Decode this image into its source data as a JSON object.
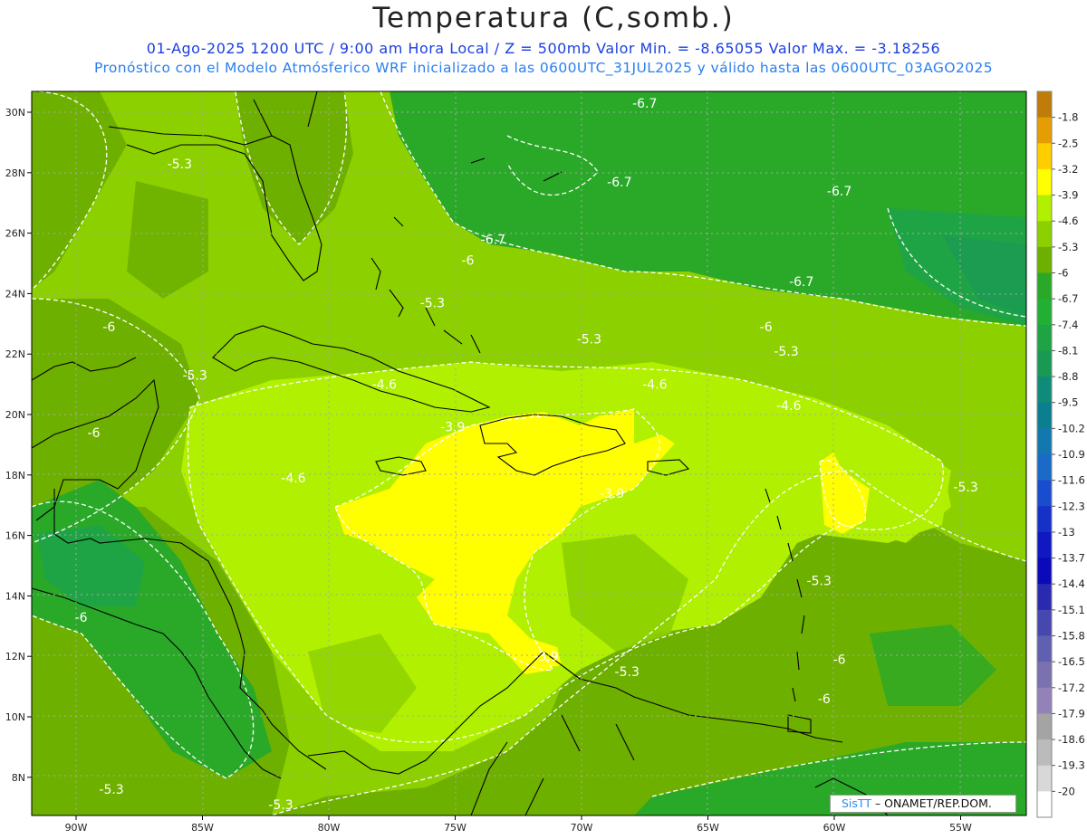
{
  "header": {
    "title": "Temperatura (C,somb.)",
    "line1": "01-Ago-2025  1200 UTC / 9:00 am Hora Local / Z = 500mb  Valor Min. = -8.65055  Valor Max. = -3.18256",
    "line2": "Pronóstico con el Modelo Atmósferico WRF inicializado a las 0600UTC_31JUL2025 y válido hasta las  0600UTC_03AGO2025"
  },
  "credit": {
    "brand": "SisTT",
    "org": " – ONAMET/REP.DOM."
  },
  "map": {
    "lat_labels": [
      "30N",
      "28N",
      "26N",
      "24N",
      "22N",
      "20N",
      "18N",
      "16N",
      "14N",
      "12N",
      "10N",
      "8N"
    ],
    "lon_labels": [
      "90W",
      "85W",
      "80W",
      "75W",
      "70W",
      "65W",
      "60W",
      "55W"
    ],
    "lat_values": [
      30,
      28,
      26,
      24,
      22,
      20,
      18,
      16,
      14,
      12,
      10,
      8
    ],
    "lon_values": [
      -90,
      -85,
      -80,
      -75,
      -70,
      -65,
      -60,
      -55
    ],
    "contour_labels": [
      {
        "text": "-6.7",
        "lon": -67.5,
        "lat": 30.3
      },
      {
        "text": "-6.7",
        "lon": -68.5,
        "lat": 27.7
      },
      {
        "text": "-6.7",
        "lon": -59.8,
        "lat": 27.4
      },
      {
        "text": "-6.7",
        "lon": -73.5,
        "lat": 25.8
      },
      {
        "text": "-6.7",
        "lon": -61.3,
        "lat": 24.4
      },
      {
        "text": "-5.3",
        "lon": -85.9,
        "lat": 28.3
      },
      {
        "text": "-6",
        "lon": -74.5,
        "lat": 25.1
      },
      {
        "text": "-5.3",
        "lon": -75.9,
        "lat": 23.7
      },
      {
        "text": "-6",
        "lon": -88.7,
        "lat": 22.9
      },
      {
        "text": "-6",
        "lon": -62.7,
        "lat": 22.9
      },
      {
        "text": "-5.3",
        "lon": -69.7,
        "lat": 22.5
      },
      {
        "text": "-5.3",
        "lon": -61.9,
        "lat": 22.1
      },
      {
        "text": "-5.3",
        "lon": -85.3,
        "lat": 21.3
      },
      {
        "text": "-4.6",
        "lon": -77.8,
        "lat": 21.0
      },
      {
        "text": "-4.6",
        "lon": -67.1,
        "lat": 21.0
      },
      {
        "text": "-4.6",
        "lon": -61.8,
        "lat": 20.3
      },
      {
        "text": "-6",
        "lon": -89.3,
        "lat": 19.4
      },
      {
        "text": "-3.9",
        "lon": -75.1,
        "lat": 19.6
      },
      {
        "text": "-4.6",
        "lon": -81.4,
        "lat": 17.9
      },
      {
        "text": "-3.9",
        "lon": -68.8,
        "lat": 17.4
      },
      {
        "text": "-5.3",
        "lon": -54.8,
        "lat": 17.6
      },
      {
        "text": "-5.3",
        "lon": -60.6,
        "lat": 14.5
      },
      {
        "text": "-6",
        "lon": -89.8,
        "lat": 13.3
      },
      {
        "text": "-3.9",
        "lon": -71.4,
        "lat": 12.0
      },
      {
        "text": "-5.3",
        "lon": -68.2,
        "lat": 11.5
      },
      {
        "text": "-6",
        "lon": -59.8,
        "lat": 11.9
      },
      {
        "text": "-6",
        "lon": -60.4,
        "lat": 10.6
      },
      {
        "text": "-5.3",
        "lon": -88.6,
        "lat": 7.6
      },
      {
        "text": "-5.3",
        "lon": -81.9,
        "lat": 7.1
      }
    ]
  },
  "colorbar": {
    "labels": [
      "-1.8",
      "-2.5",
      "-3.2",
      "-3.9",
      "-4.6",
      "-5.3",
      "-6",
      "-6.7",
      "-7.4",
      "-8.1",
      "-8.8",
      "-9.5",
      "-10.2",
      "-10.9",
      "-11.6",
      "-12.3",
      "-13",
      "-13.7",
      "-14.4",
      "-15.1",
      "-15.8",
      "-16.5",
      "-17.2",
      "-17.9",
      "-18.6",
      "-19.3",
      "-20"
    ],
    "colors": [
      "#c07c08",
      "#e59d03",
      "#ffcd00",
      "#ffff00",
      "#b0f000",
      "#8cd000",
      "#6eb000",
      "#2aa928",
      "#22b034",
      "#1fa445",
      "#1a9955",
      "#0f8b7a",
      "#0a7f90",
      "#1478b0",
      "#1a6ac8",
      "#1a4cd0",
      "#1531c8",
      "#1018c2",
      "#0a0aba",
      "#2a2ab0",
      "#4747b0",
      "#6060b0",
      "#7a72b0",
      "#9282b8",
      "#a4a4a4",
      "#bbbbbb",
      "#d8d8d8",
      "#ffffff"
    ]
  }
}
